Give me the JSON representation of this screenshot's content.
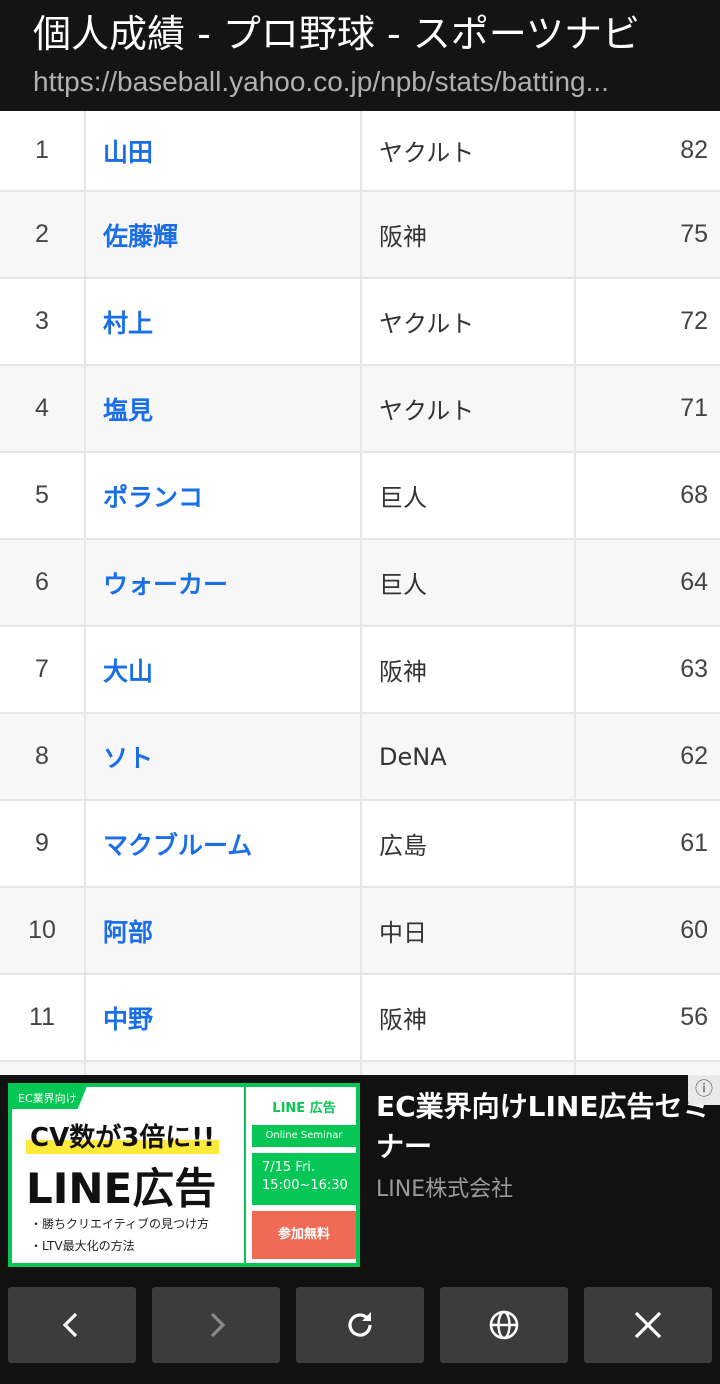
{
  "header": {
    "title": "個人成績 - プロ野球 - スポーツナビ",
    "url": "https://baseball.yahoo.co.jp/npb/stats/batting..."
  },
  "table": {
    "rows": [
      {
        "rank": "1",
        "name": "山田",
        "team": "ヤクルト",
        "value": "82"
      },
      {
        "rank": "2",
        "name": "佐藤輝",
        "team": "阪神",
        "value": "75"
      },
      {
        "rank": "3",
        "name": "村上",
        "team": "ヤクルト",
        "value": "72"
      },
      {
        "rank": "4",
        "name": "塩見",
        "team": "ヤクルト",
        "value": "71"
      },
      {
        "rank": "5",
        "name": "ポランコ",
        "team": "巨人",
        "value": "68"
      },
      {
        "rank": "6",
        "name": "ウォーカー",
        "team": "巨人",
        "value": "64"
      },
      {
        "rank": "7",
        "name": "大山",
        "team": "阪神",
        "value": "63"
      },
      {
        "rank": "8",
        "name": "ソト",
        "team": "DeNA",
        "value": "62"
      },
      {
        "rank": "9",
        "name": "マクブルーム",
        "team": "広島",
        "value": "61"
      },
      {
        "rank": "10",
        "name": "阿部",
        "team": "中日",
        "value": "60"
      },
      {
        "rank": "11",
        "name": "中野",
        "team": "阪神",
        "value": "56"
      },
      {
        "rank": "",
        "name": "",
        "team": "",
        "value": ""
      }
    ]
  },
  "ad": {
    "tag": "EC業界向け",
    "cv_text": "CV数が3倍に!!",
    "line_text": "LINE広告",
    "bullet1": "・勝ちクリエイティブの見つけ方",
    "bullet2": "・LTV最大化の方法",
    "brand": "LINE 広告",
    "seminar": "Online Seminar",
    "date": "7/15 Fri.",
    "time": "15:00~16:30",
    "join": "参加無料",
    "headline": "EC業界向けLINE広告セミナー",
    "advertiser": "LINE株式会社",
    "info_icon": "info-icon"
  },
  "navbar": {
    "icons": [
      "back-icon",
      "forward-icon",
      "reload-icon",
      "globe-icon",
      "close-icon"
    ]
  },
  "colors": {
    "link": "#1a6fe8",
    "line_green": "#06c755",
    "header_bg": "#141414"
  }
}
